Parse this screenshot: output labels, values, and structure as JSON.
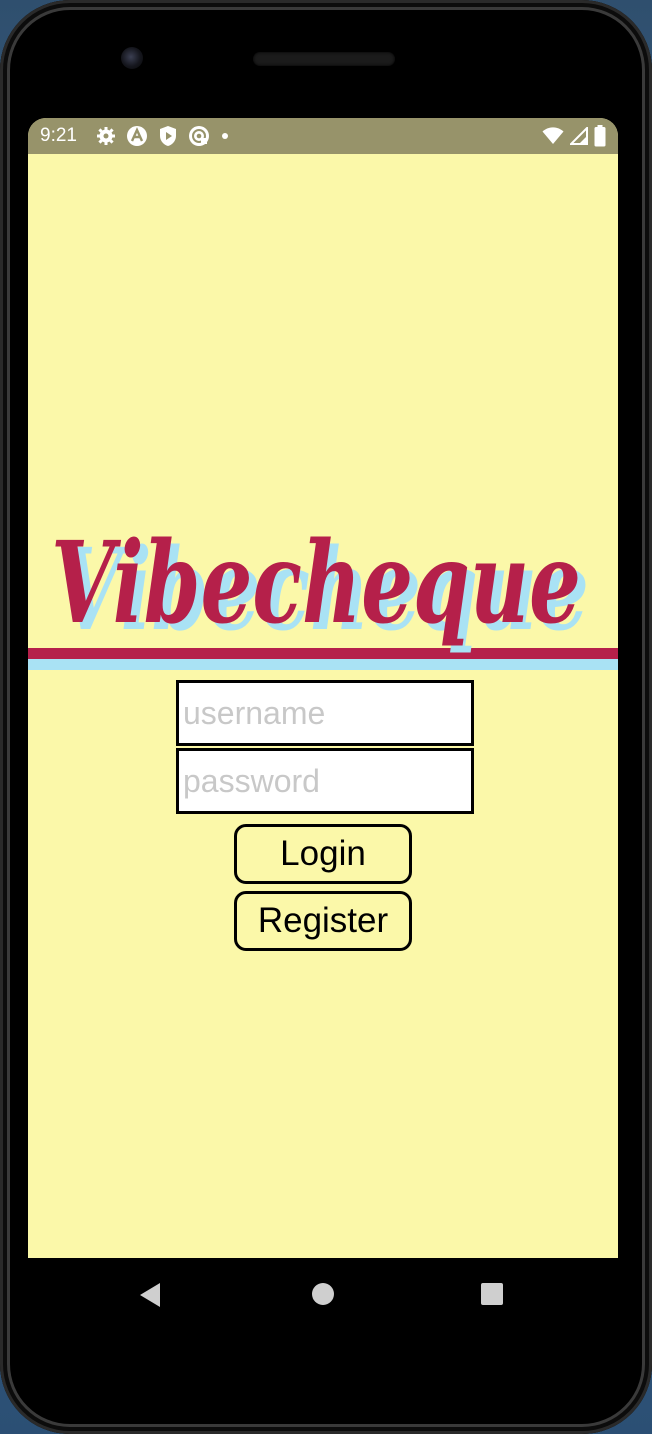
{
  "status_bar": {
    "time": "9:21",
    "left_icons": [
      "settings-icon",
      "notification-icon",
      "shield-play-icon",
      "cast-icon",
      "dot-icon"
    ],
    "right_icons": [
      "wifi-icon",
      "signal-icon",
      "battery-icon"
    ]
  },
  "app": {
    "logo_text": "Vibecheque",
    "username_placeholder": "username",
    "password_placeholder": "password",
    "login_label": "Login",
    "register_label": "Register"
  },
  "nav_bar": {
    "icons": [
      "back-icon",
      "home-icon",
      "recents-icon"
    ]
  },
  "colors": {
    "background": "#fbf8a9",
    "status_bar": "#97936a",
    "logo_primary": "#b5204a",
    "logo_shadow": "#a9e2f4"
  }
}
